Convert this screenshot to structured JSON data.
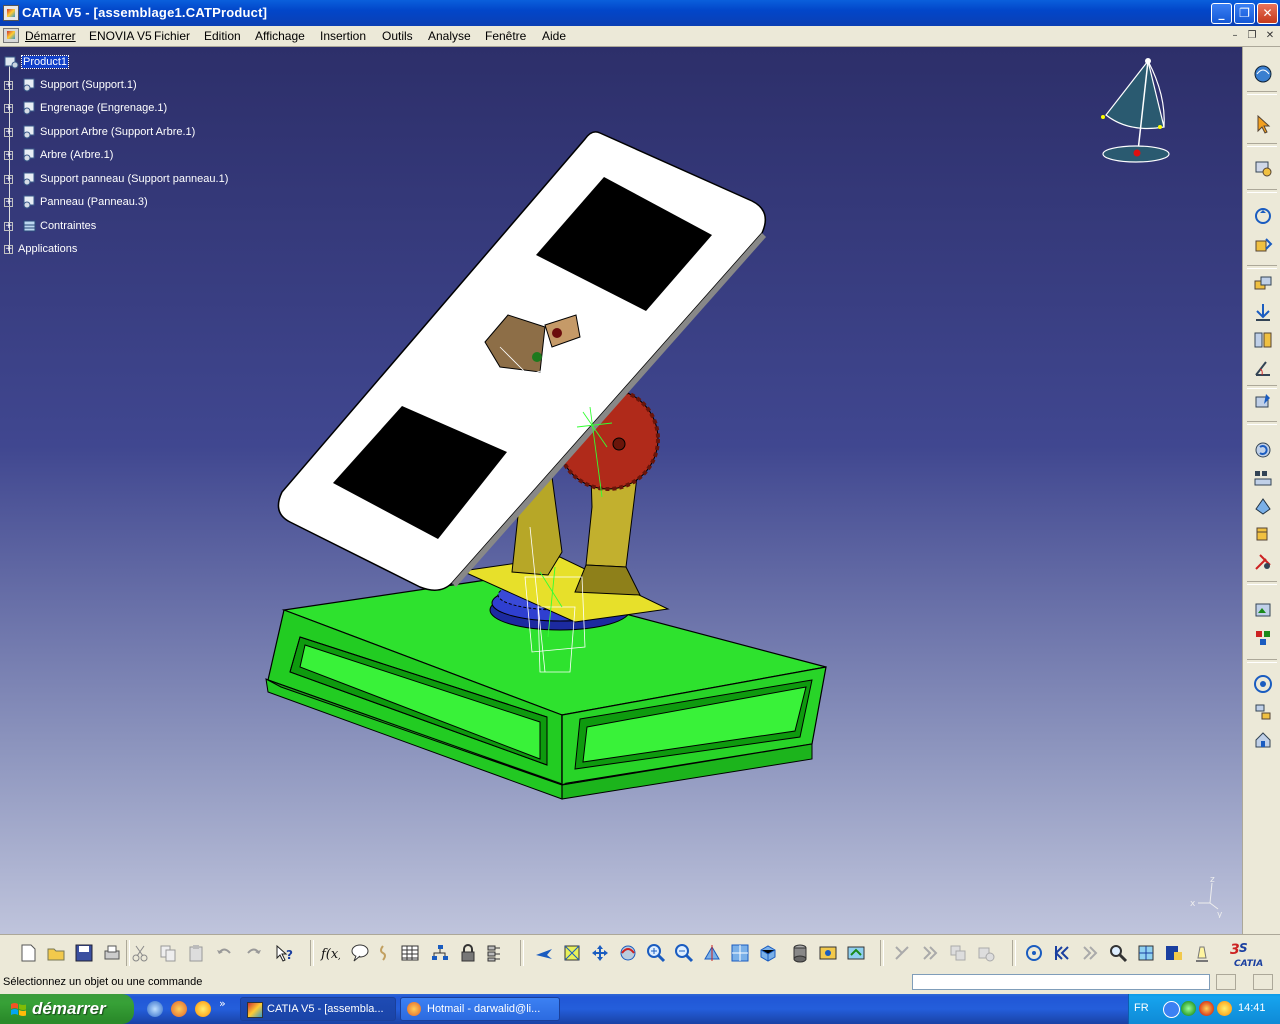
{
  "window": {
    "title": "CATIA V5 - [assemblage1.CATProduct]",
    "minimize_glyph": "_",
    "maximize_glyph": "❐",
    "close_glyph": "✕"
  },
  "menu": {
    "items": [
      "Démarrer",
      "ENOVIA V5",
      "Fichier",
      "Edition",
      "Affichage",
      "Insertion",
      "Outils",
      "Analyse",
      "Fenêtre",
      "Aide"
    ],
    "mdi_min": "–",
    "mdi_restore": "❐",
    "mdi_close": "✕"
  },
  "tree": {
    "root": "Product1",
    "children": [
      "Support (Support.1)",
      "Engrenage (Engrenage.1)",
      "Support Arbre (Support Arbre.1)",
      "Arbre (Arbre.1)",
      "Support panneau (Support panneau.1)",
      "Panneau (Panneau.3)",
      "Contraintes"
    ],
    "applications": "Applications"
  },
  "compass": {
    "axis_x": "x",
    "axis_y": "y",
    "axis_z": "z"
  },
  "status": {
    "message": "Sélectionnez un objet ou une commande",
    "command_value": ""
  },
  "taskbar": {
    "start_label": "démarrer",
    "tasks": [
      "CATIA V5 - [assembla...",
      "Hotmail - darwalid@li..."
    ],
    "quicklaunch_more": "»",
    "language": "FR",
    "clock": "14:41"
  },
  "colors": {
    "viewport_top": "#2d2f6a",
    "viewport_bottom": "#bfc4dc",
    "base_green": "#22dd22",
    "panel_white": "#ffffff",
    "support_yellow": "#b9a830",
    "gear_red": "#a8281a",
    "gear_blue": "#2233aa",
    "titlebar_blue": "#0246c9"
  },
  "logo": {
    "text": "CATIA"
  }
}
